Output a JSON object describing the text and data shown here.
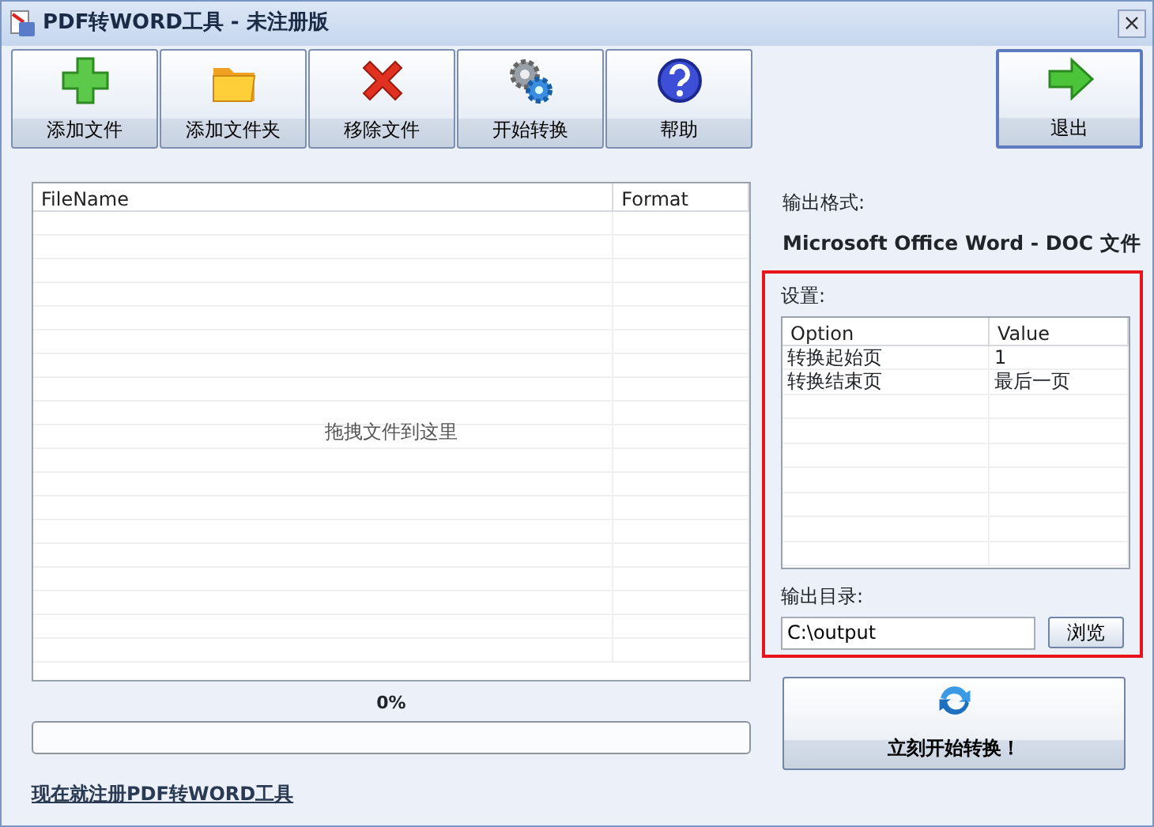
{
  "window": {
    "title": "PDF转WORD工具 - 未注册版",
    "close": "×"
  },
  "toolbar": [
    {
      "label": "添加文件"
    },
    {
      "label": "添加文件夹"
    },
    {
      "label": "移除文件"
    },
    {
      "label": "开始转换"
    },
    {
      "label": "帮助"
    }
  ],
  "exit_button": {
    "label": "退出"
  },
  "file_table": {
    "columns": [
      "FileName",
      "Format"
    ],
    "drop_hint": "拖拽文件到这里"
  },
  "progress": {
    "reading": "0%",
    "level": 0
  },
  "register_link": "现在就注册PDF转WORD工具",
  "output_format": {
    "label": "输出格式:",
    "value": "Microsoft Office Word - DOC 文件"
  },
  "settings": {
    "label": "设置:",
    "columns": [
      "Option",
      "Value"
    ],
    "rows": [
      {
        "option": "转换起始页",
        "value": "1"
      },
      {
        "option": "转换结束页",
        "value": "最后一页"
      }
    ]
  },
  "output_dir": {
    "label": "输出目录:",
    "value": "C:\\output",
    "browse": "浏览"
  },
  "convert_button": {
    "label": "立刻开始转换！"
  }
}
